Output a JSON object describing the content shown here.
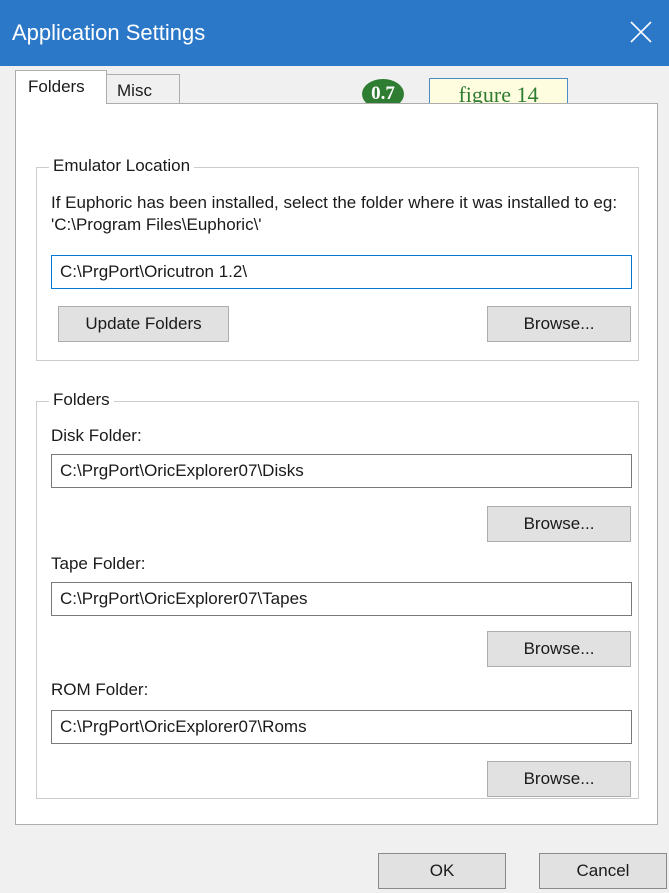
{
  "window": {
    "title": "Application Settings",
    "close_icon": "close-icon",
    "accent_color": "#2b78c9"
  },
  "tabs": [
    {
      "label": "Folders",
      "selected": true
    },
    {
      "label": "Misc",
      "selected": false
    }
  ],
  "annotation": {
    "badge": "0.7",
    "figure": "figure 14"
  },
  "emulator": {
    "legend": "Emulator Location",
    "description": "If Euphoric has been installed, select the folder where it was installed to eg: 'C:\\Program Files\\Euphoric\\'",
    "path": "C:\\PrgPort\\Oricutron 1.2\\",
    "update_button": "Update Folders",
    "browse_button": "Browse..."
  },
  "folders": {
    "legend": "Folders",
    "disk_label": "Disk Folder:",
    "disk_path": "C:\\PrgPort\\OricExplorer07\\Disks",
    "tape_label": "Tape Folder:",
    "tape_path": "C:\\PrgPort\\OricExplorer07\\Tapes",
    "rom_label": "ROM Folder:",
    "rom_path": "C:\\PrgPort\\OricExplorer07\\Roms",
    "browse_button": "Browse..."
  },
  "dialog": {
    "ok_button": "OK",
    "cancel_button": "Cancel"
  }
}
